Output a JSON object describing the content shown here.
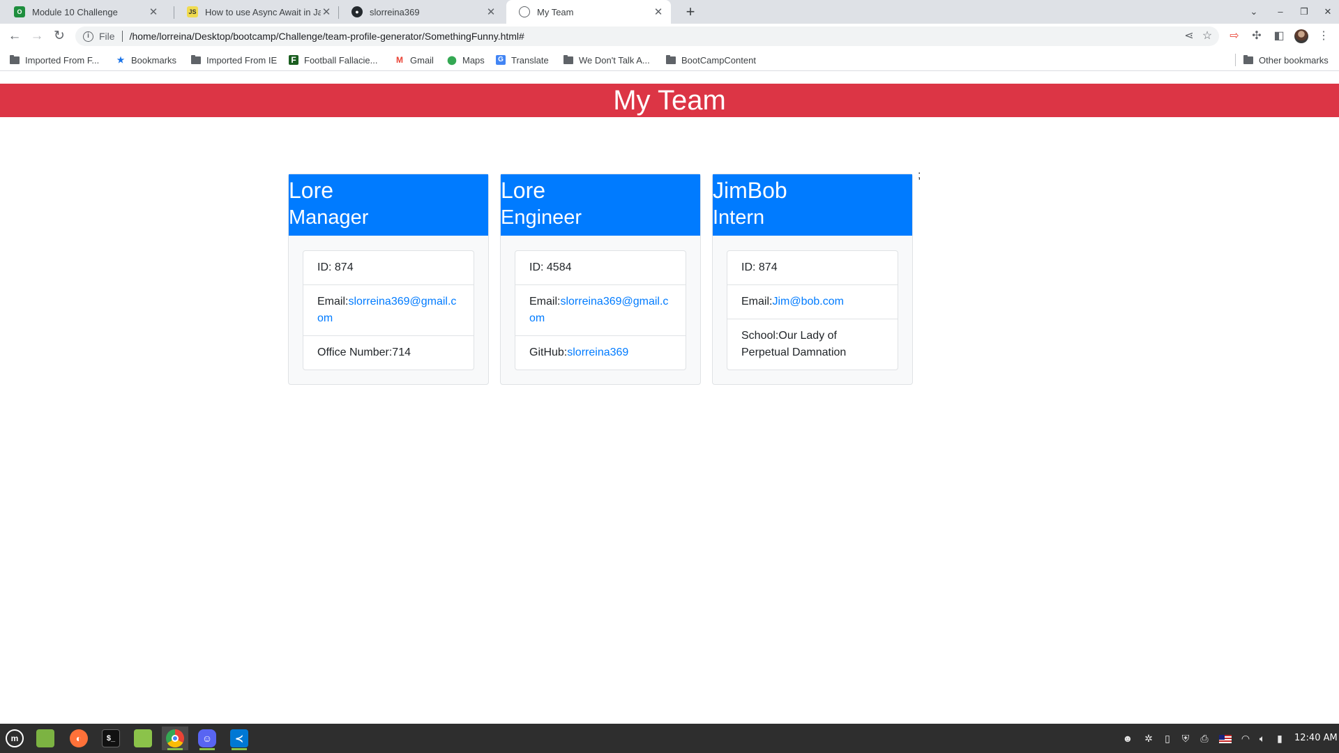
{
  "browser": {
    "tabs": [
      {
        "title": "Module 10 Challenge",
        "favicon": "square-green-icon"
      },
      {
        "title": "How to use Async Await in JavaScript",
        "favicon": "js-icon"
      },
      {
        "title": "slorreina369",
        "favicon": "github-icon"
      },
      {
        "title": "My Team",
        "favicon": "globe-icon"
      }
    ],
    "active_tab": 3,
    "omnibox": {
      "scheme_label": "File",
      "url": "/home/lorreina/Desktop/bootcamp/Challenge/team-profile-generator/SomethingFunny.html#"
    },
    "bookmarks": [
      {
        "label": "Imported From F...",
        "icon": "folder-icon"
      },
      {
        "label": "Bookmarks",
        "icon": "star-icon"
      },
      {
        "label": "Imported From IE",
        "icon": "folder-icon"
      },
      {
        "label": "Football Fallacie...",
        "icon": "site-icon"
      },
      {
        "label": "Gmail",
        "icon": "gmail-icon"
      },
      {
        "label": "Maps",
        "icon": "maps-icon"
      },
      {
        "label": "Translate",
        "icon": "translate-icon"
      },
      {
        "label": "We Don't Talk A...",
        "icon": "folder-icon"
      },
      {
        "label": "BootCampContent",
        "icon": "folder-icon"
      }
    ],
    "other_bookmarks": "Other bookmarks"
  },
  "page": {
    "heading": "My Team",
    "stray_text": ";",
    "cards": [
      {
        "name": "Lore",
        "role": "Manager",
        "id_label": "ID: ",
        "id": "874",
        "email_label": "Email:",
        "email": "slorreina369@gmail.com",
        "extra_label": "Office Number:",
        "extra_value": "714",
        "extra_is_link": false
      },
      {
        "name": "Lore",
        "role": "Engineer",
        "id_label": "ID: ",
        "id": "4584",
        "email_label": "Email:",
        "email": "slorreina369@gmail.com",
        "extra_label": "GitHub:",
        "extra_value": "slorreina369",
        "extra_is_link": true
      },
      {
        "name": "JimBob",
        "role": "Intern",
        "id_label": "ID: ",
        "id": "874",
        "email_label": "Email:",
        "email": "Jim@bob.com",
        "extra_label": "School:",
        "extra_value": "Our Lady of Perpetual Damnation",
        "extra_is_link": false
      }
    ],
    "colors": {
      "header_bg": "#dc3545",
      "card_header_bg": "#007bff",
      "link": "#007bff"
    }
  },
  "taskbar": {
    "apps": [
      "mint-menu-icon",
      "files-icon",
      "firefox-icon",
      "terminal-icon",
      "folder-icon",
      "chrome-icon",
      "discord-icon",
      "vscode-icon"
    ],
    "clock": "12:40 AM"
  }
}
